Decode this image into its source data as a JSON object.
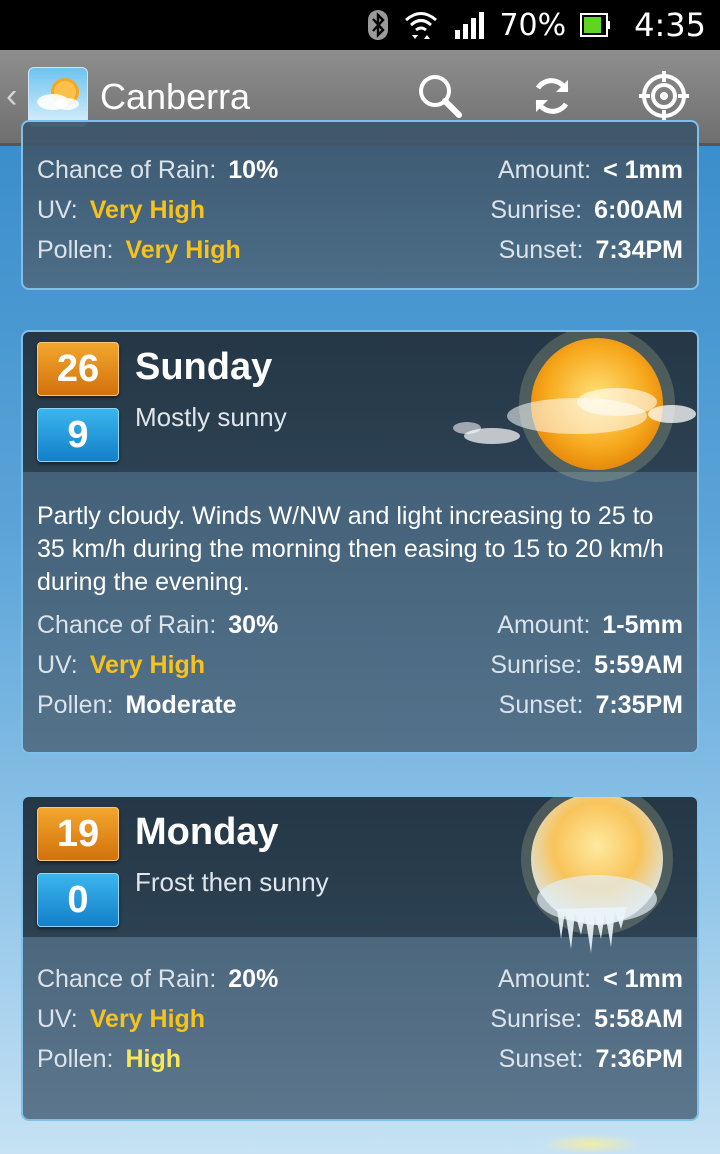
{
  "status_bar": {
    "battery": "70%",
    "time": "4:35"
  },
  "action_bar": {
    "title": "Canberra"
  },
  "cards": [
    {
      "rain_label": "Chance of Rain:",
      "rain": "10%",
      "uv_label": "UV:",
      "uv": "Very High",
      "pollen_label": "Pollen:",
      "pollen": "Very High",
      "amount_label": "Amount:",
      "amount": "< 1mm",
      "sunrise_label": "Sunrise:",
      "sunrise": "6:00AM",
      "sunset_label": "Sunset:",
      "sunset": "7:34PM"
    },
    {
      "high": "26",
      "low": "9",
      "day": "Sunday",
      "summary": "Mostly sunny",
      "icon": "partly-cloudy-icon",
      "forecast": "Partly cloudy. Winds W/NW and light increasing to 25 to 35 km/h during the morning then easing to 15 to 20 km/h during the evening.",
      "rain_label": "Chance of Rain:",
      "rain": "30%",
      "uv_label": "UV:",
      "uv": "Very High",
      "pollen_label": "Pollen:",
      "pollen": "Moderate",
      "amount_label": "Amount:",
      "amount": "1-5mm",
      "sunrise_label": "Sunrise:",
      "sunrise": "5:59AM",
      "sunset_label": "Sunset:",
      "sunset": "7:35PM"
    },
    {
      "high": "19",
      "low": "0",
      "day": "Monday",
      "summary": "Frost then sunny",
      "icon": "frost-sun-icon",
      "rain_label": "Chance of Rain:",
      "rain": "20%",
      "uv_label": "UV:",
      "uv": "Very High",
      "pollen_label": "Pollen:",
      "pollen": "High",
      "amount_label": "Amount:",
      "amount": "< 1mm",
      "sunrise_label": "Sunrise:",
      "sunrise": "5:58AM",
      "sunset_label": "Sunset:",
      "sunset": "7:36PM"
    }
  ],
  "colors": {
    "uv_very_high": "#f7c21c",
    "pollen_very_high": "#f7c21c",
    "pollen_high": "#f8e85a",
    "high_badge": "#e08a1a",
    "low_badge": "#1f97de"
  }
}
